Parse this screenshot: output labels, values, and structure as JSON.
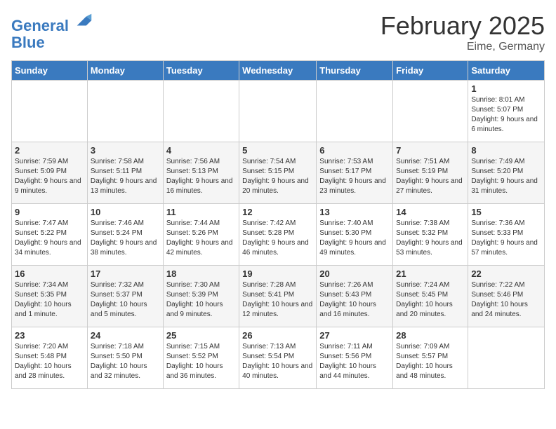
{
  "header": {
    "logo_line1": "General",
    "logo_line2": "Blue",
    "month": "February 2025",
    "location": "Eime, Germany"
  },
  "weekdays": [
    "Sunday",
    "Monday",
    "Tuesday",
    "Wednesday",
    "Thursday",
    "Friday",
    "Saturday"
  ],
  "weeks": [
    [
      {
        "day": "",
        "info": ""
      },
      {
        "day": "",
        "info": ""
      },
      {
        "day": "",
        "info": ""
      },
      {
        "day": "",
        "info": ""
      },
      {
        "day": "",
        "info": ""
      },
      {
        "day": "",
        "info": ""
      },
      {
        "day": "1",
        "info": "Sunrise: 8:01 AM\nSunset: 5:07 PM\nDaylight: 9 hours and 6 minutes."
      }
    ],
    [
      {
        "day": "2",
        "info": "Sunrise: 7:59 AM\nSunset: 5:09 PM\nDaylight: 9 hours and 9 minutes."
      },
      {
        "day": "3",
        "info": "Sunrise: 7:58 AM\nSunset: 5:11 PM\nDaylight: 9 hours and 13 minutes."
      },
      {
        "day": "4",
        "info": "Sunrise: 7:56 AM\nSunset: 5:13 PM\nDaylight: 9 hours and 16 minutes."
      },
      {
        "day": "5",
        "info": "Sunrise: 7:54 AM\nSunset: 5:15 PM\nDaylight: 9 hours and 20 minutes."
      },
      {
        "day": "6",
        "info": "Sunrise: 7:53 AM\nSunset: 5:17 PM\nDaylight: 9 hours and 23 minutes."
      },
      {
        "day": "7",
        "info": "Sunrise: 7:51 AM\nSunset: 5:19 PM\nDaylight: 9 hours and 27 minutes."
      },
      {
        "day": "8",
        "info": "Sunrise: 7:49 AM\nSunset: 5:20 PM\nDaylight: 9 hours and 31 minutes."
      }
    ],
    [
      {
        "day": "9",
        "info": "Sunrise: 7:47 AM\nSunset: 5:22 PM\nDaylight: 9 hours and 34 minutes."
      },
      {
        "day": "10",
        "info": "Sunrise: 7:46 AM\nSunset: 5:24 PM\nDaylight: 9 hours and 38 minutes."
      },
      {
        "day": "11",
        "info": "Sunrise: 7:44 AM\nSunset: 5:26 PM\nDaylight: 9 hours and 42 minutes."
      },
      {
        "day": "12",
        "info": "Sunrise: 7:42 AM\nSunset: 5:28 PM\nDaylight: 9 hours and 46 minutes."
      },
      {
        "day": "13",
        "info": "Sunrise: 7:40 AM\nSunset: 5:30 PM\nDaylight: 9 hours and 49 minutes."
      },
      {
        "day": "14",
        "info": "Sunrise: 7:38 AM\nSunset: 5:32 PM\nDaylight: 9 hours and 53 minutes."
      },
      {
        "day": "15",
        "info": "Sunrise: 7:36 AM\nSunset: 5:33 PM\nDaylight: 9 hours and 57 minutes."
      }
    ],
    [
      {
        "day": "16",
        "info": "Sunrise: 7:34 AM\nSunset: 5:35 PM\nDaylight: 10 hours and 1 minute."
      },
      {
        "day": "17",
        "info": "Sunrise: 7:32 AM\nSunset: 5:37 PM\nDaylight: 10 hours and 5 minutes."
      },
      {
        "day": "18",
        "info": "Sunrise: 7:30 AM\nSunset: 5:39 PM\nDaylight: 10 hours and 9 minutes."
      },
      {
        "day": "19",
        "info": "Sunrise: 7:28 AM\nSunset: 5:41 PM\nDaylight: 10 hours and 12 minutes."
      },
      {
        "day": "20",
        "info": "Sunrise: 7:26 AM\nSunset: 5:43 PM\nDaylight: 10 hours and 16 minutes."
      },
      {
        "day": "21",
        "info": "Sunrise: 7:24 AM\nSunset: 5:45 PM\nDaylight: 10 hours and 20 minutes."
      },
      {
        "day": "22",
        "info": "Sunrise: 7:22 AM\nSunset: 5:46 PM\nDaylight: 10 hours and 24 minutes."
      }
    ],
    [
      {
        "day": "23",
        "info": "Sunrise: 7:20 AM\nSunset: 5:48 PM\nDaylight: 10 hours and 28 minutes."
      },
      {
        "day": "24",
        "info": "Sunrise: 7:18 AM\nSunset: 5:50 PM\nDaylight: 10 hours and 32 minutes."
      },
      {
        "day": "25",
        "info": "Sunrise: 7:15 AM\nSunset: 5:52 PM\nDaylight: 10 hours and 36 minutes."
      },
      {
        "day": "26",
        "info": "Sunrise: 7:13 AM\nSunset: 5:54 PM\nDaylight: 10 hours and 40 minutes."
      },
      {
        "day": "27",
        "info": "Sunrise: 7:11 AM\nSunset: 5:56 PM\nDaylight: 10 hours and 44 minutes."
      },
      {
        "day": "28",
        "info": "Sunrise: 7:09 AM\nSunset: 5:57 PM\nDaylight: 10 hours and 48 minutes."
      },
      {
        "day": "",
        "info": ""
      }
    ]
  ]
}
